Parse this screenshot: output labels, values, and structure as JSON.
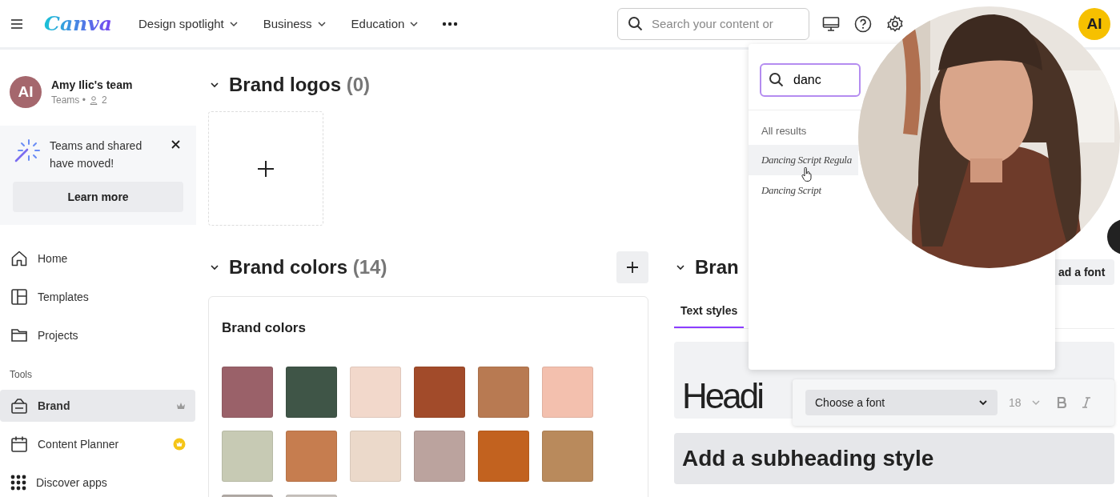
{
  "header": {
    "logo": "Canva",
    "nav": [
      {
        "label": "Design spotlight"
      },
      {
        "label": "Business"
      },
      {
        "label": "Education"
      }
    ],
    "search": {
      "placeholder": "Search your content or"
    },
    "avatar": "AI"
  },
  "sidebar": {
    "team": {
      "initials": "AI",
      "name": "Amy Ilic's team",
      "meta": "Teams •",
      "members": "2"
    },
    "notice": {
      "text": "Teams and shared have moved!",
      "button": "Learn more"
    },
    "items": [
      {
        "kind": "home",
        "label": "Home",
        "selected": false
      },
      {
        "kind": "templates",
        "label": "Templates",
        "selected": false
      },
      {
        "kind": "projects",
        "label": "Projects",
        "selected": false
      }
    ],
    "tools_label": "Tools",
    "tools": [
      {
        "kind": "brand",
        "label": "Brand",
        "selected": true
      },
      {
        "kind": "planner",
        "label": "Content Planner",
        "selected": false
      },
      {
        "kind": "apps",
        "label": "Discover apps",
        "selected": false
      }
    ]
  },
  "logos": {
    "title": "Brand logos",
    "count": "(0)"
  },
  "colors": {
    "title": "Brand colors",
    "count": "(14)",
    "card_title": "Brand colors",
    "swatches": [
      {
        "color": "#9a6169"
      },
      {
        "color": "#3f5547"
      },
      {
        "color": "#f2d8cb"
      },
      {
        "color": "#a24b2a"
      },
      {
        "color": "#b87a52"
      },
      {
        "color": "#f3c0ae"
      },
      {
        "color": "#c7cab4"
      },
      {
        "color": "#c67d4f"
      },
      {
        "color": "#ebd9ca"
      },
      {
        "color": "#bba39e"
      },
      {
        "color": "#c2621f"
      },
      {
        "color": "#b98a5c"
      },
      {
        "color": "#b3aca7"
      },
      {
        "color": "#c9c4bf"
      }
    ]
  },
  "fonts": {
    "title": "Bran",
    "upload": "ad a font",
    "tabs": [
      {
        "label": "Text styles",
        "selected": true
      }
    ],
    "heading_sample": "Headi",
    "subheading_sample": "Add a subheading style"
  },
  "font_search": {
    "value": "danc",
    "results_label": "All results",
    "results": [
      {
        "label": "Dancing Script Regula",
        "hovered": true
      },
      {
        "label": "Dancing Script",
        "hovered": false
      }
    ]
  },
  "font_toolbar": {
    "font": "Choose a font",
    "size": "18"
  }
}
